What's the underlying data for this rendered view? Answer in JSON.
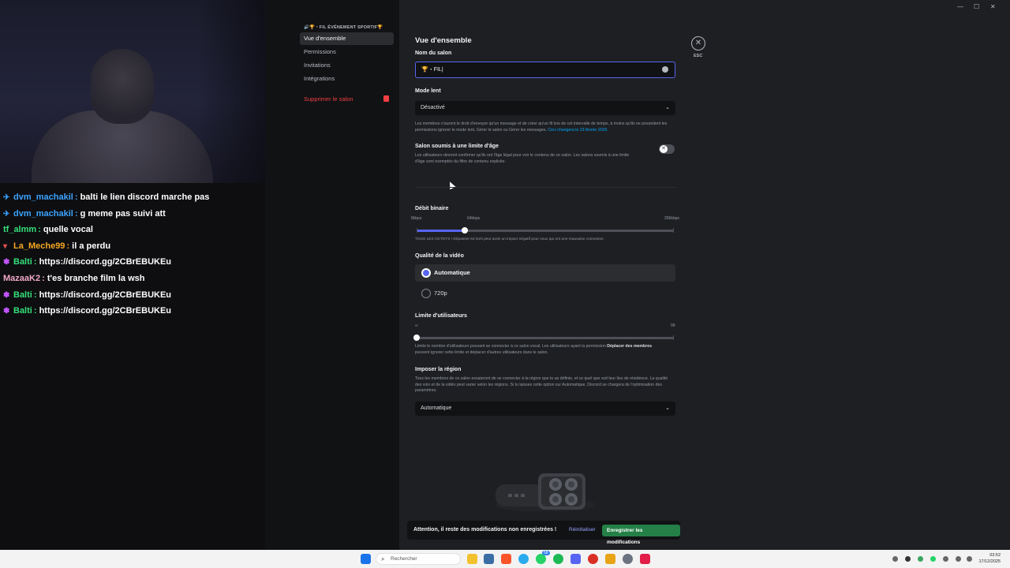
{
  "window": {
    "minimize": "—",
    "maximize": "☐",
    "close": "✕"
  },
  "chat": [
    {
      "badge": "✈",
      "badge_color": "#3ba3ff",
      "user": "dvm_machakil",
      "user_color": "#3ba3ff",
      "message": "balti le lien discord marche pas"
    },
    {
      "badge": "✈",
      "badge_color": "#3ba3ff",
      "user": "dvm_machakil",
      "user_color": "#3ba3ff",
      "message": "g meme pas suivi att"
    },
    {
      "badge": "",
      "badge_color": "",
      "user": "tf_almm",
      "user_color": "#35e07a",
      "message": "quelle vocal"
    },
    {
      "badge": "▾",
      "badge_color": "#e05050",
      "user": "La_Meche99",
      "user_color": "#f5a623",
      "message": "il a perdu"
    },
    {
      "badge": "✽",
      "badge_color": "#c155ff",
      "user": "Balti",
      "user_color": "#35e07a",
      "message": "https://discord.gg/2CBrEBUKEu"
    },
    {
      "badge": "",
      "badge_color": "",
      "user": "MazaaK2",
      "user_color": "#f0a8c8",
      "message": "t'es branche film la wsh"
    },
    {
      "badge": "✽",
      "badge_color": "#c155ff",
      "user": "Balti",
      "user_color": "#35e07a",
      "message": "https://discord.gg/2CBrEBUKEu"
    },
    {
      "badge": "✽",
      "badge_color": "#c155ff",
      "user": "Balti",
      "user_color": "#35e07a",
      "message": "https://discord.gg/2CBrEBUKEu"
    }
  ],
  "sidebar": {
    "header": "🔊🏆・FIL ÉVÉNEMENT SPORTIF🏆",
    "items": [
      {
        "label": "Vue d'ensemble"
      },
      {
        "label": "Permissions"
      },
      {
        "label": "Invitations"
      },
      {
        "label": "Intégrations"
      }
    ],
    "delete_label": "Supprimer le salon"
  },
  "settings": {
    "title": "Vue d'ensemble",
    "close_label": "ESC",
    "channel_name": {
      "label": "Nom du salon",
      "value": "🏆・FIL"
    },
    "slow_mode": {
      "label": "Mode lent",
      "value": "Désactivé",
      "help": "Les membres n'auront le droit d'envoyer qu'un message et de créer qu'un fil lors de cet intervalle de temps, à moins qu'ils ne possèdent les permissions ignorer le mode lent, Gérer le salon ou Gérer les messages.",
      "help_link": "Ceci changera le 23 février 2026."
    },
    "age_restricted": {
      "label": "Salon soumis à une limite d'âge",
      "help": "Les utilisateurs devront confirmer qu'ils ont l'âge légal pour voir le contenu de ce salon. Les salons soumis à une limite d'âge sont exemptés du filtre de contenu explicite.",
      "enabled": false,
      "knob_glyph": "✕"
    },
    "bitrate": {
      "label": "Débit binaire",
      "min_label": "8kbps",
      "mid_label": "64kbps",
      "max_label": "256kbps",
      "value_kbps": 64,
      "help": "TOUS LES OCTETS ! Dépasser 64 ko/s peut avoir un impact négatif pour ceux qui ont une mauvaise connexion."
    },
    "video_quality": {
      "label": "Qualité de la vidéo",
      "options": [
        {
          "label": "Automatique",
          "selected": true
        },
        {
          "label": "720p",
          "selected": false
        }
      ]
    },
    "user_limit": {
      "label": "Limite d'utilisateurs",
      "min_label": "∞",
      "max_label": "99",
      "value": 0,
      "help_pre": "Limite le nombre d'utilisateurs pouvant se connecter à ce salon vocal. Les utilisateurs ayant la permission ",
      "help_bold": "Déplacer des membres",
      "help_post": " peuvent ignorer cette limite et déplacer d'autres utilisateurs dans le salon."
    },
    "region": {
      "label": "Imposer la région",
      "help": "Tous les membres de ce salon essaieront de se connecter à la région que tu as définie, et ce quel que soit leur lieu de résidence. La qualité des voix et de la vidéo peut varier selon les régions. Si tu laisses cette option sur Automatique, Discord se chargera de l'optimisation des paramètres.",
      "value": "Automatique"
    },
    "unsaved_bar": {
      "message": "Attention, il reste des modifications non enregistrées !",
      "reset_label": "Réinitialiser",
      "save_label": "Enregistrer les modifications"
    }
  },
  "taskbar": {
    "search_placeholder": "Rechercher",
    "time": "03:52",
    "date": "17/12/2025",
    "badge_count": "58"
  },
  "colors": {
    "accent": "#5865f2",
    "save_green": "#248046",
    "danger": "#f23f43"
  }
}
